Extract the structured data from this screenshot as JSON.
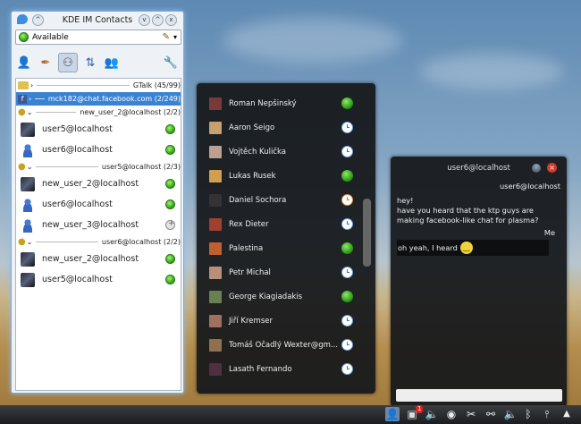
{
  "contacts_window": {
    "title": "KDE IM Contacts",
    "status": "Available",
    "groups": [
      {
        "label": "GTalk (45/99)",
        "selected": false
      },
      {
        "label": "mck182@chat.facebook.com (2/249)",
        "selected": true
      },
      {
        "label": "new_user_2@localhost (2/2)",
        "selected": false,
        "contacts": [
          {
            "name": "user5@localhost",
            "status": "online"
          },
          {
            "name": "user6@localhost",
            "status": "online"
          }
        ]
      },
      {
        "label": "user5@localhost (2/3)",
        "selected": false,
        "contacts": [
          {
            "name": "new_user_2@localhost",
            "status": "online"
          },
          {
            "name": "user6@localhost",
            "status": "online"
          },
          {
            "name": "new_user_3@localhost",
            "status": "offline"
          }
        ]
      },
      {
        "label": "user6@localhost (2/2)",
        "selected": false,
        "contacts": [
          {
            "name": "new_user_2@localhost",
            "status": "online"
          },
          {
            "name": "user5@localhost",
            "status": "online"
          }
        ]
      }
    ]
  },
  "plasma_contacts": [
    {
      "name": "Roman Nepšinský",
      "status": "online"
    },
    {
      "name": "Aaron Seigo",
      "status": "away"
    },
    {
      "name": "Vojtěch Kulička",
      "status": "away"
    },
    {
      "name": "Lukas Rusek",
      "status": "online"
    },
    {
      "name": "Daniel Sochora",
      "status": "busy"
    },
    {
      "name": "Rex Dieter",
      "status": "away"
    },
    {
      "name": "Palestina",
      "status": "online"
    },
    {
      "name": "Petr Michal",
      "status": "away"
    },
    {
      "name": "George Kiagiadakis",
      "status": "online"
    },
    {
      "name": "Jiří Kremser",
      "status": "away"
    },
    {
      "name": "Tomáš Očadlý Wexter@gm...",
      "status": "away"
    },
    {
      "name": "Lasath Fernando",
      "status": "away"
    }
  ],
  "chat_widget": {
    "title": "user6@localhost",
    "sender_header": "user6@localhost",
    "incoming": "hey!\nhave you heard that the ktp guys are making facebook-like chat for plasma?",
    "self_name": "Me",
    "outgoing": "oh yeah, I heard",
    "emoticon": "smiley-icon"
  },
  "taskbar": {
    "icons": [
      "contacts-icon",
      "notification-icon",
      "volume-icon",
      "steam-icon",
      "kde-connect-icon",
      "network-icon",
      "volume2-icon",
      "bluetooth-icon",
      "wifi-icon",
      "expand-icon"
    ],
    "notification_count": "1"
  },
  "colors": {
    "accent": "#3a83d3",
    "online": "#2e9d10",
    "away": "#7aa3d8"
  }
}
